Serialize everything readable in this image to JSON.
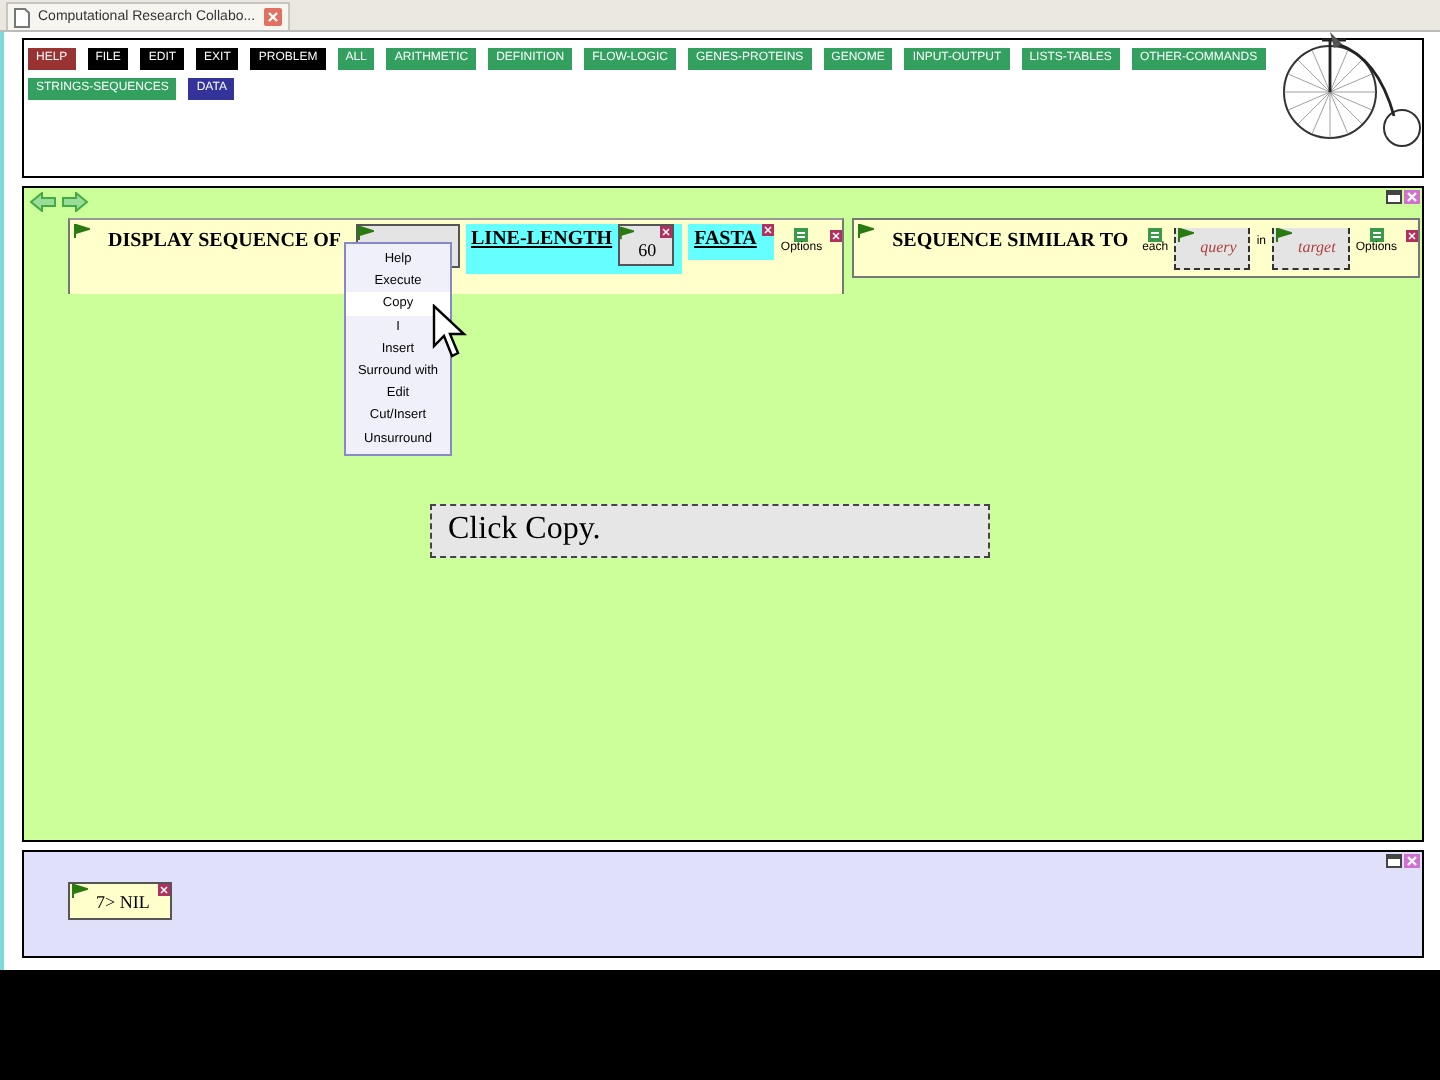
{
  "browser_tab": {
    "title": "Computational Research Collabo..."
  },
  "menu_buttons": [
    {
      "label": "HELP",
      "kind": "help"
    },
    {
      "label": "FILE",
      "kind": "system"
    },
    {
      "label": "EDIT",
      "kind": "system"
    },
    {
      "label": "EXIT",
      "kind": "system"
    },
    {
      "label": "PROBLEM",
      "kind": "system"
    },
    {
      "label": "ALL",
      "kind": "function"
    },
    {
      "label": "ARITHMETIC",
      "kind": "function"
    },
    {
      "label": "DEFINITION",
      "kind": "function"
    },
    {
      "label": "FLOW-LOGIC",
      "kind": "function"
    },
    {
      "label": "GENES-PROTEINS",
      "kind": "function"
    },
    {
      "label": "GENOME",
      "kind": "function"
    },
    {
      "label": "INPUT-OUTPUT",
      "kind": "function"
    },
    {
      "label": "LISTS-TABLES",
      "kind": "function"
    },
    {
      "label": "OTHER-COMMANDS",
      "kind": "function"
    },
    {
      "label": "STRINGS-SEQUENCES",
      "kind": "function"
    },
    {
      "label": "DATA",
      "kind": "data"
    }
  ],
  "display_box": {
    "label": "DISPLAY SEQUENCE OF",
    "keyword": "LINE-LENGTH",
    "keyword_value": "60",
    "flag": "FASTA",
    "options": "Options"
  },
  "similar_box": {
    "label": "SEQUENCE SIMILAR TO",
    "each": "each",
    "query": "query",
    "in": "in",
    "target": "target",
    "options": "Options"
  },
  "context_menu": [
    {
      "label": "Help",
      "selected": false
    },
    {
      "label": "Execute",
      "selected": false
    },
    {
      "label": "Copy",
      "selected": true
    },
    {
      "label": "I",
      "selected": false
    },
    {
      "label": "Insert",
      "selected": false
    },
    {
      "label": "Surround with",
      "selected": false
    },
    {
      "label": "Edit",
      "selected": false
    },
    {
      "label": "Cut/Insert",
      "selected": false
    },
    {
      "label": "Unsurround",
      "selected": false
    }
  ],
  "hint": "Click Copy.",
  "result": "7> NIL"
}
